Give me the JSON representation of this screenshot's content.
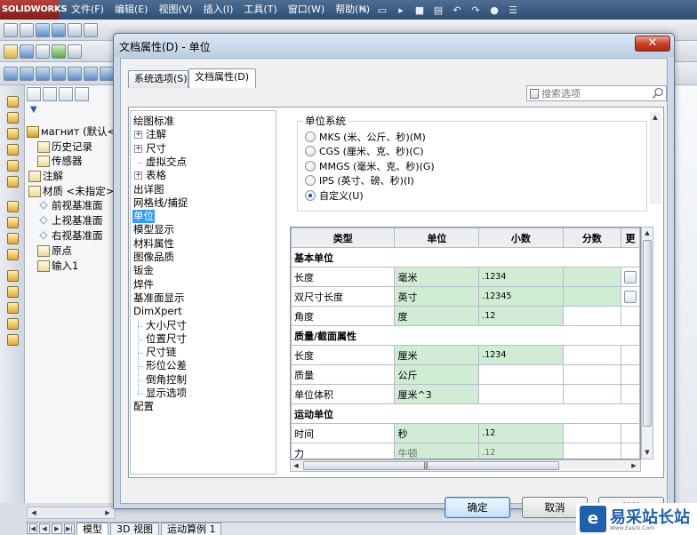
{
  "app": {
    "logo_text": "SOLIDWORKS",
    "menu": [
      "文件(F)",
      "编辑(E)",
      "视图(V)",
      "插入(I)",
      "工具(T)",
      "窗口(W)",
      "帮助(H)"
    ]
  },
  "feature_tree": {
    "items": [
      {
        "label": "магнит  (默认<",
        "icon": "part-icon"
      },
      {
        "label": "历史记录",
        "icon": "history-icon"
      },
      {
        "label": "传感器",
        "icon": "sensor-icon"
      },
      {
        "label": "注解",
        "icon": "annotation-icon"
      },
      {
        "label": "材质 <未指定>",
        "icon": "material-icon"
      },
      {
        "label": "前视基准面",
        "icon": "plane-icon"
      },
      {
        "label": "上视基准面",
        "icon": "plane-icon"
      },
      {
        "label": "右视基准面",
        "icon": "plane-icon"
      },
      {
        "label": "原点",
        "icon": "origin-icon"
      },
      {
        "label": "输入1",
        "icon": "import-icon"
      }
    ]
  },
  "bottom_tabs": [
    "模型",
    "3D 视图",
    "运动算例 1"
  ],
  "dialog": {
    "title": "文档属性(D) - 单位",
    "close_label": "✕",
    "tabs": [
      "系统选项(S)",
      "文档属性(D)"
    ],
    "active_tab": 1,
    "search_placeholder": "搜索选项",
    "nav": [
      "绘图标准",
      "注解",
      "尺寸",
      "虚拟交点",
      "表格",
      "出详图",
      "网格线/捕捉",
      "单位",
      "模型显示",
      "材料属性",
      "图像品质",
      "钣金",
      "焊件",
      "基准面显示",
      "DimXpert",
      "大小尺寸",
      "位置尺寸",
      "尺寸链",
      "形位公差",
      "倒角控制",
      "显示选项",
      "配置"
    ],
    "unit_system": {
      "legend": "单位系统",
      "options": [
        {
          "label": "MKS (米、公斤、秒)(M)",
          "checked": false
        },
        {
          "label": "CGS (厘米、克、秒)(C)",
          "checked": false
        },
        {
          "label": "MMGS (毫米、克、秒)(G)",
          "checked": false
        },
        {
          "label": "IPS (英寸、磅、秒)(I)",
          "checked": false
        },
        {
          "label": "自定义(U)",
          "checked": true
        }
      ]
    },
    "grid": {
      "headers": [
        "类型",
        "单位",
        "小数",
        "分数",
        "更"
      ],
      "rows": [
        {
          "kind": "group",
          "type": "基本单位"
        },
        {
          "kind": "row",
          "type": "长度",
          "unit": "毫米",
          "decimal": ".1234",
          "fraction": "",
          "more": true
        },
        {
          "kind": "row",
          "type": "双尺寸长度",
          "unit": "英寸",
          "decimal": ".12345",
          "fraction": "",
          "more": true
        },
        {
          "kind": "row",
          "type": "角度",
          "unit": "度",
          "decimal": ".12",
          "fraction": "",
          "more": false
        },
        {
          "kind": "group",
          "type": "质量/截面属性"
        },
        {
          "kind": "row",
          "type": "长度",
          "unit": "厘米",
          "decimal": ".1234",
          "fraction": "",
          "more": false
        },
        {
          "kind": "row",
          "type": "质量",
          "unit": "公斤",
          "decimal": "",
          "fraction": "",
          "more": false
        },
        {
          "kind": "row",
          "type": "单位体积",
          "unit": "厘米^3",
          "decimal": "",
          "fraction": "",
          "more": false
        },
        {
          "kind": "group",
          "type": "运动单位"
        },
        {
          "kind": "row",
          "type": "时间",
          "unit": "秒",
          "decimal": ".12",
          "fraction": "",
          "more": false
        },
        {
          "kind": "row",
          "type": "力",
          "unit": "牛顿",
          "decimal": ".12",
          "fraction": "",
          "more": false,
          "muted": true
        }
      ]
    },
    "buttons": {
      "ok": "确定",
      "cancel": "取消",
      "help": "帮助"
    }
  },
  "watermark": {
    "logo": "e",
    "text": "易采站长站",
    "sub": "Www.Easck.Com"
  }
}
